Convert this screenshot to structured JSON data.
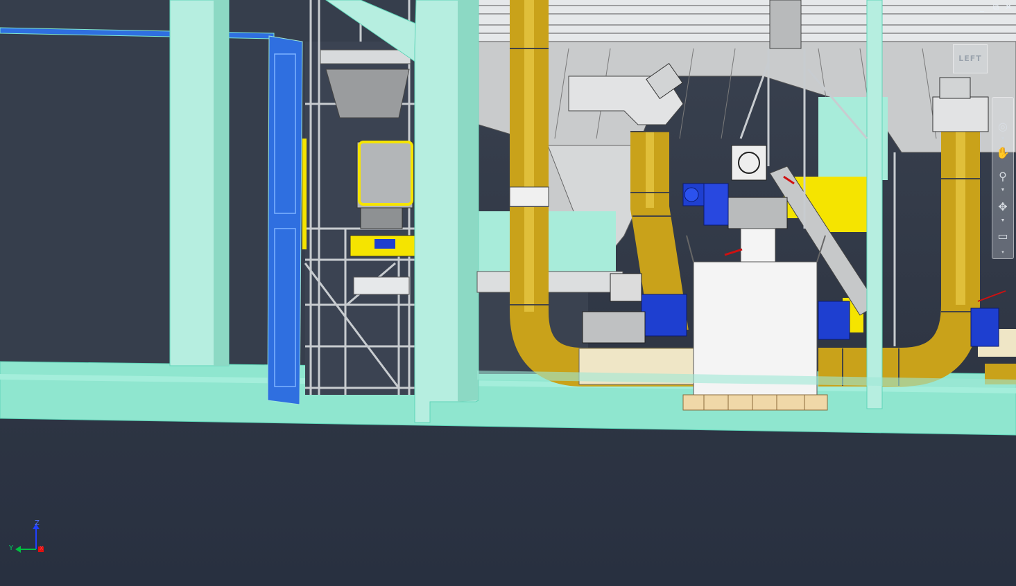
{
  "window": {
    "minimize_glyph": "_",
    "restore_glyph": "⧉",
    "close_glyph": "✕"
  },
  "viewcube": {
    "face_label": "LEFT"
  },
  "navigation_bar": {
    "tools": [
      {
        "name": "steering-wheel-icon",
        "glyph": "◎"
      },
      {
        "name": "pan-icon",
        "glyph": "✋"
      },
      {
        "name": "zoom-icon",
        "glyph": "⚲"
      },
      {
        "name": "orbit-icon",
        "glyph": "✥"
      },
      {
        "name": "showmotion-icon",
        "glyph": "▭"
      }
    ]
  },
  "ucs_triad": {
    "z_label": "Z",
    "y_label": "Y",
    "x_label": "X"
  },
  "colors": {
    "background_top": "#3a4250",
    "background_bottom": "#283040",
    "steel_frame": "#9fe8d6",
    "pipe_yellow": "#c9a21a",
    "motor_blue": "#1e3fd0",
    "door_blue": "#2f6fe0",
    "safety_yellow": "#f5e400",
    "hopper_gray": "#c9cbcc"
  }
}
